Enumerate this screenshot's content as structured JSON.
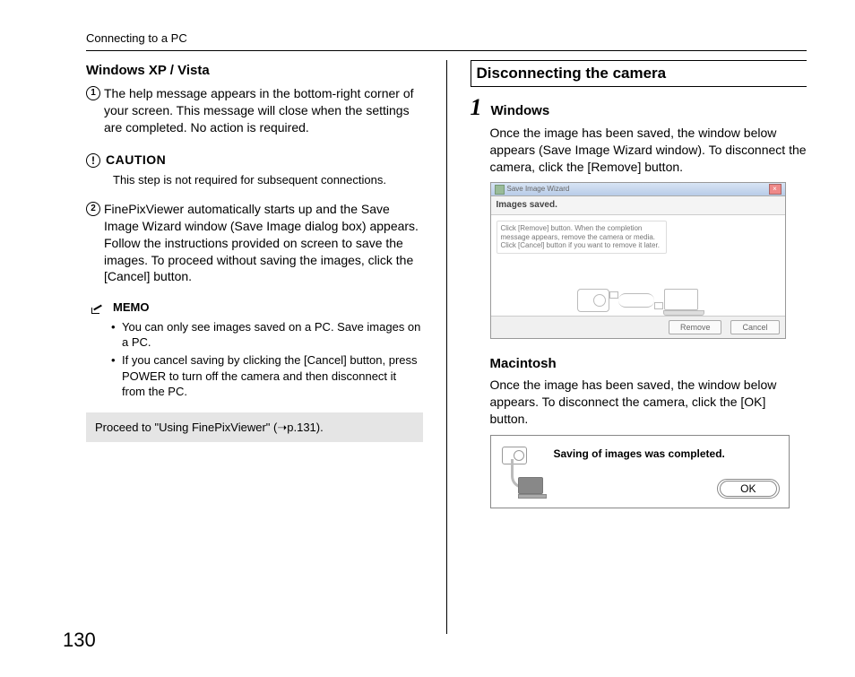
{
  "header": "Connecting to a PC",
  "page_number": "130",
  "left": {
    "h1": "Windows XP / Vista",
    "step1_num": "1",
    "step1": "The help message appears in the bottom-right corner of your screen. This message will close when the settings are completed. No action is required.",
    "caution_label": "CAUTION",
    "caution_text": "This step is not required for subsequent connections.",
    "step2_num": "2",
    "step2": "FinePixViewer automatically starts up and the Save Image Wizard window (Save Image dialog box) appears. Follow the instructions provided on screen to save the images. To proceed without saving the images, click the [Cancel] button.",
    "memo_label": "MEMO",
    "memo1": "You can only see images saved on a PC. Save images on a PC.",
    "memo2": "If you cancel saving by clicking the [Cancel] button, press POWER to turn off the camera and then disconnect it from the PC.",
    "proceed": "Proceed to \"Using FinePixViewer\" (➝p.131)."
  },
  "right": {
    "section": "Disconnecting the camera",
    "step_num": "1",
    "win_heading": "Windows",
    "win_body": "Once the image has been saved, the window below appears (Save Image Wizard window). To disconnect the camera, click the [Remove] button.",
    "dialog_win": {
      "title": "Save Image Wizard",
      "status": "Images saved.",
      "instr": "Click [Remove] button. When the completion message appears, remove the camera or media. Click [Cancel] button if you want to remove it later.",
      "btn_remove": "Remove",
      "btn_cancel": "Cancel"
    },
    "mac_heading": "Macintosh",
    "mac_body": "Once the image has been saved, the window below appears. To disconnect the camera, click the [OK] button.",
    "dialog_mac": {
      "msg": "Saving of images was completed.",
      "btn_ok": "OK"
    }
  }
}
